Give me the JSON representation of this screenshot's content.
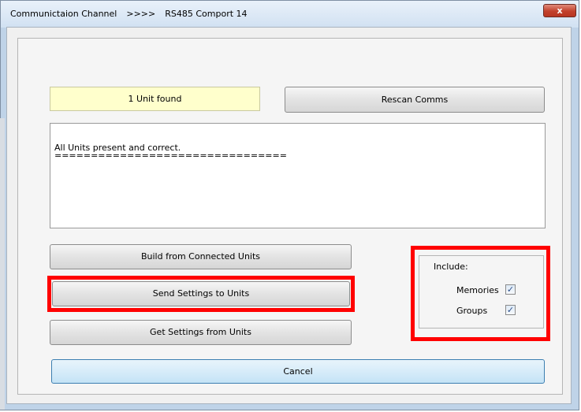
{
  "window": {
    "title_parts": [
      "Communictaion Channel",
      ">>>>",
      "RS485 Comport 14"
    ],
    "close_label": "x"
  },
  "status": {
    "text": "1 Unit found"
  },
  "buttons": {
    "rescan": "Rescan Comms",
    "build": "Build from Connected Units",
    "send": "Send Settings to Units",
    "get": "Get Settings from Units",
    "cancel": "Cancel"
  },
  "log": {
    "lines": [
      "All Units present and correct.",
      "================================"
    ]
  },
  "include": {
    "title": "Include:",
    "memories_label": "Memories",
    "memories_checked": true,
    "groups_label": "Groups",
    "groups_checked": true
  },
  "highlight_color": "#ff0000"
}
